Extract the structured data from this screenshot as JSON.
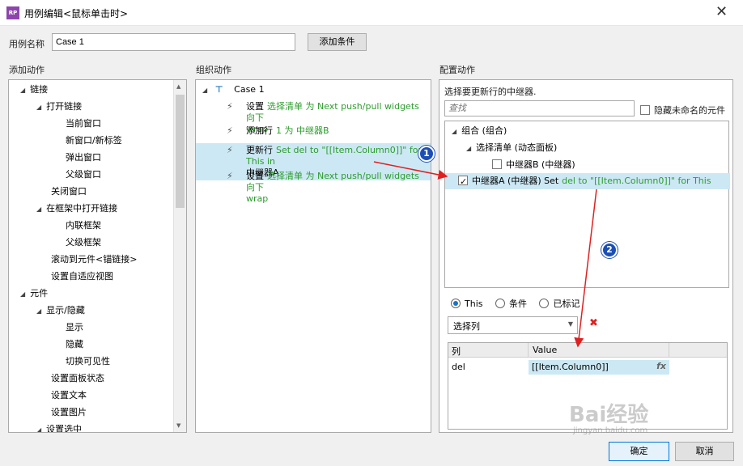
{
  "window": {
    "title": "用例编辑<鼠标单击时>",
    "logo": "RP",
    "close": "✕"
  },
  "case_name": {
    "label": "用例名称",
    "value": "Case 1",
    "add_condition": "添加条件"
  },
  "headers": {
    "add_action": "添加动作",
    "organize_action": "组织动作",
    "configure_action": "配置动作"
  },
  "add_action_tree": [
    {
      "label": "链接",
      "arrow": "◢"
    },
    {
      "label": "打开链接",
      "arrow": "◢"
    },
    {
      "label": "当前窗口"
    },
    {
      "label": "新窗口/新标签"
    },
    {
      "label": "弹出窗口"
    },
    {
      "label": "父级窗口"
    },
    {
      "label": "关闭窗口"
    },
    {
      "label": "在框架中打开链接",
      "arrow": "◢"
    },
    {
      "label": "内联框架"
    },
    {
      "label": "父级框架"
    },
    {
      "label": "滚动到元件<锚链接>"
    },
    {
      "label": "设置自适应视图"
    },
    {
      "label": "元件",
      "arrow": "◢"
    },
    {
      "label": "显示/隐藏",
      "arrow": "◢"
    },
    {
      "label": "显示"
    },
    {
      "label": "隐藏"
    },
    {
      "label": "切换可见性"
    },
    {
      "label": "设置面板状态"
    },
    {
      "label": "设置文本"
    },
    {
      "label": "设置图片"
    },
    {
      "label": "设置选中",
      "arrow": "◢"
    }
  ],
  "organize": {
    "case_label": "Case 1",
    "case_arrow": "◢",
    "actions": [
      {
        "verb": "设置",
        "line1": "选择清单 为 Next push/pull widgets 向下",
        "line2": "wrap"
      },
      {
        "verb": "添加行",
        "line1": "1 为 中继器B",
        "line2": ""
      },
      {
        "verb": "更新行",
        "line1": "Set del to \"[[Item.Column0]]\" for This in",
        "line2": "中继器A"
      },
      {
        "verb": "设置",
        "line1": "选择清单 为 Next push/pull widgets 向下",
        "line2": "wrap"
      }
    ]
  },
  "configure": {
    "prompt": "选择要更新行的中继器.",
    "search_placeholder": "查找",
    "hide_unnamed": "隐藏未命名的元件",
    "tree": [
      {
        "label": "组合 (组合)",
        "arrow": "◢"
      },
      {
        "label": "选择清单 (动态面板)",
        "arrow": "◢"
      },
      {
        "label": "中继器B (中继器)",
        "checked": false
      },
      {
        "label": "中继器A (中继器) Set",
        "action": "del to \"[[Item.Column0]]\" for This",
        "checked": true
      }
    ],
    "radios": {
      "this": "This",
      "condition": "条件",
      "marked": "已标记"
    },
    "select_column": "选择列",
    "delete": "✖",
    "table_headers": {
      "col": "列",
      "value": "Value"
    },
    "rows": [
      {
        "col": "del",
        "value": "[[Item.Column0]]",
        "fx": "fx"
      }
    ]
  },
  "badges": {
    "one": "1",
    "two": "2"
  },
  "footer": {
    "ok": "确定",
    "cancel": "取消"
  },
  "watermark": {
    "brand": "Bai经验",
    "url": "jingyan.baidu.com"
  },
  "colors": {
    "accent_selected": "#cce8f4",
    "green_text": "#2e9c2e",
    "arrow_red": "#e02020",
    "badge_blue": "#1b4fb5"
  }
}
